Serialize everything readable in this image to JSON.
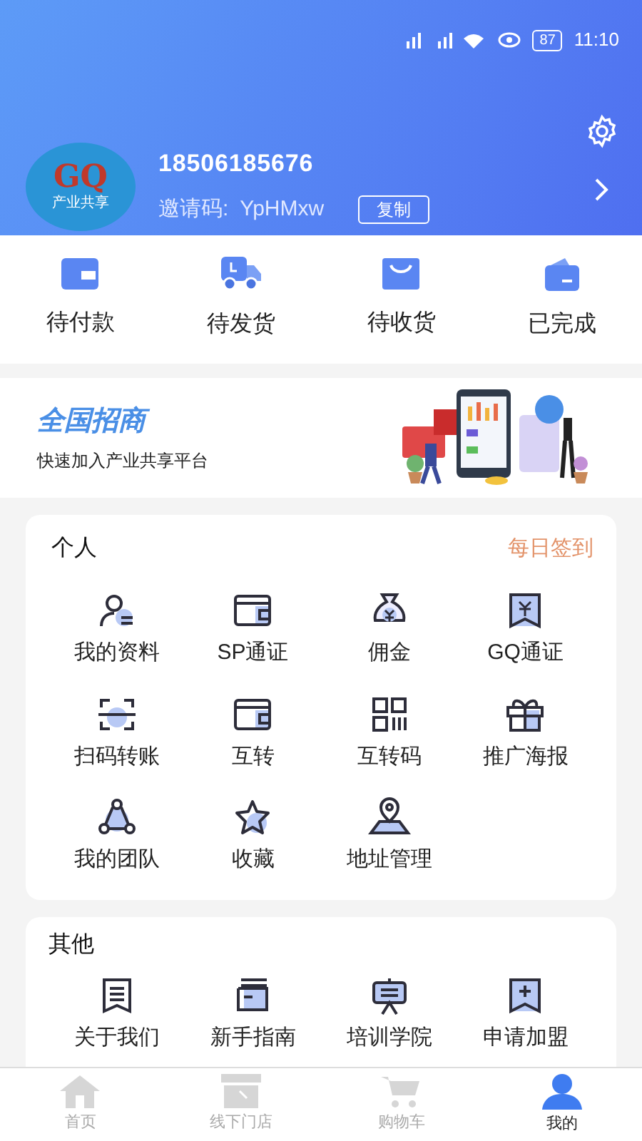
{
  "status_bar": {
    "battery": "87",
    "time": "11:10"
  },
  "profile": {
    "logo": {
      "letters": "GQ",
      "caption": "产业共享"
    },
    "phone": "18506185676",
    "invite_label": "邀请码:",
    "invite_code": "YpHMxw",
    "copy_button": "复制"
  },
  "orders": [
    {
      "label": "待付款"
    },
    {
      "label": "待发货"
    },
    {
      "label": "待收货"
    },
    {
      "label": "已完成"
    }
  ],
  "banner": {
    "title": "全国招商",
    "subtitle": "快速加入产业共享平台"
  },
  "personal": {
    "title": "个人",
    "action": "每日签到",
    "items": [
      {
        "label": "我的资料"
      },
      {
        "label": "SP通证"
      },
      {
        "label": "佣金"
      },
      {
        "label": "GQ通证"
      },
      {
        "label": "扫码转账"
      },
      {
        "label": "互转"
      },
      {
        "label": "互转码"
      },
      {
        "label": "推广海报"
      },
      {
        "label": "我的团队"
      },
      {
        "label": "收藏"
      },
      {
        "label": "地址管理"
      }
    ]
  },
  "other": {
    "title": "其他",
    "items": [
      {
        "label": "关于我们"
      },
      {
        "label": "新手指南"
      },
      {
        "label": "培训学院"
      },
      {
        "label": "申请加盟"
      }
    ]
  },
  "nav": [
    {
      "label": "首页",
      "selected": false
    },
    {
      "label": "线下门店",
      "selected": false
    },
    {
      "label": "购物车",
      "selected": false
    },
    {
      "label": "我的",
      "selected": true
    }
  ]
}
